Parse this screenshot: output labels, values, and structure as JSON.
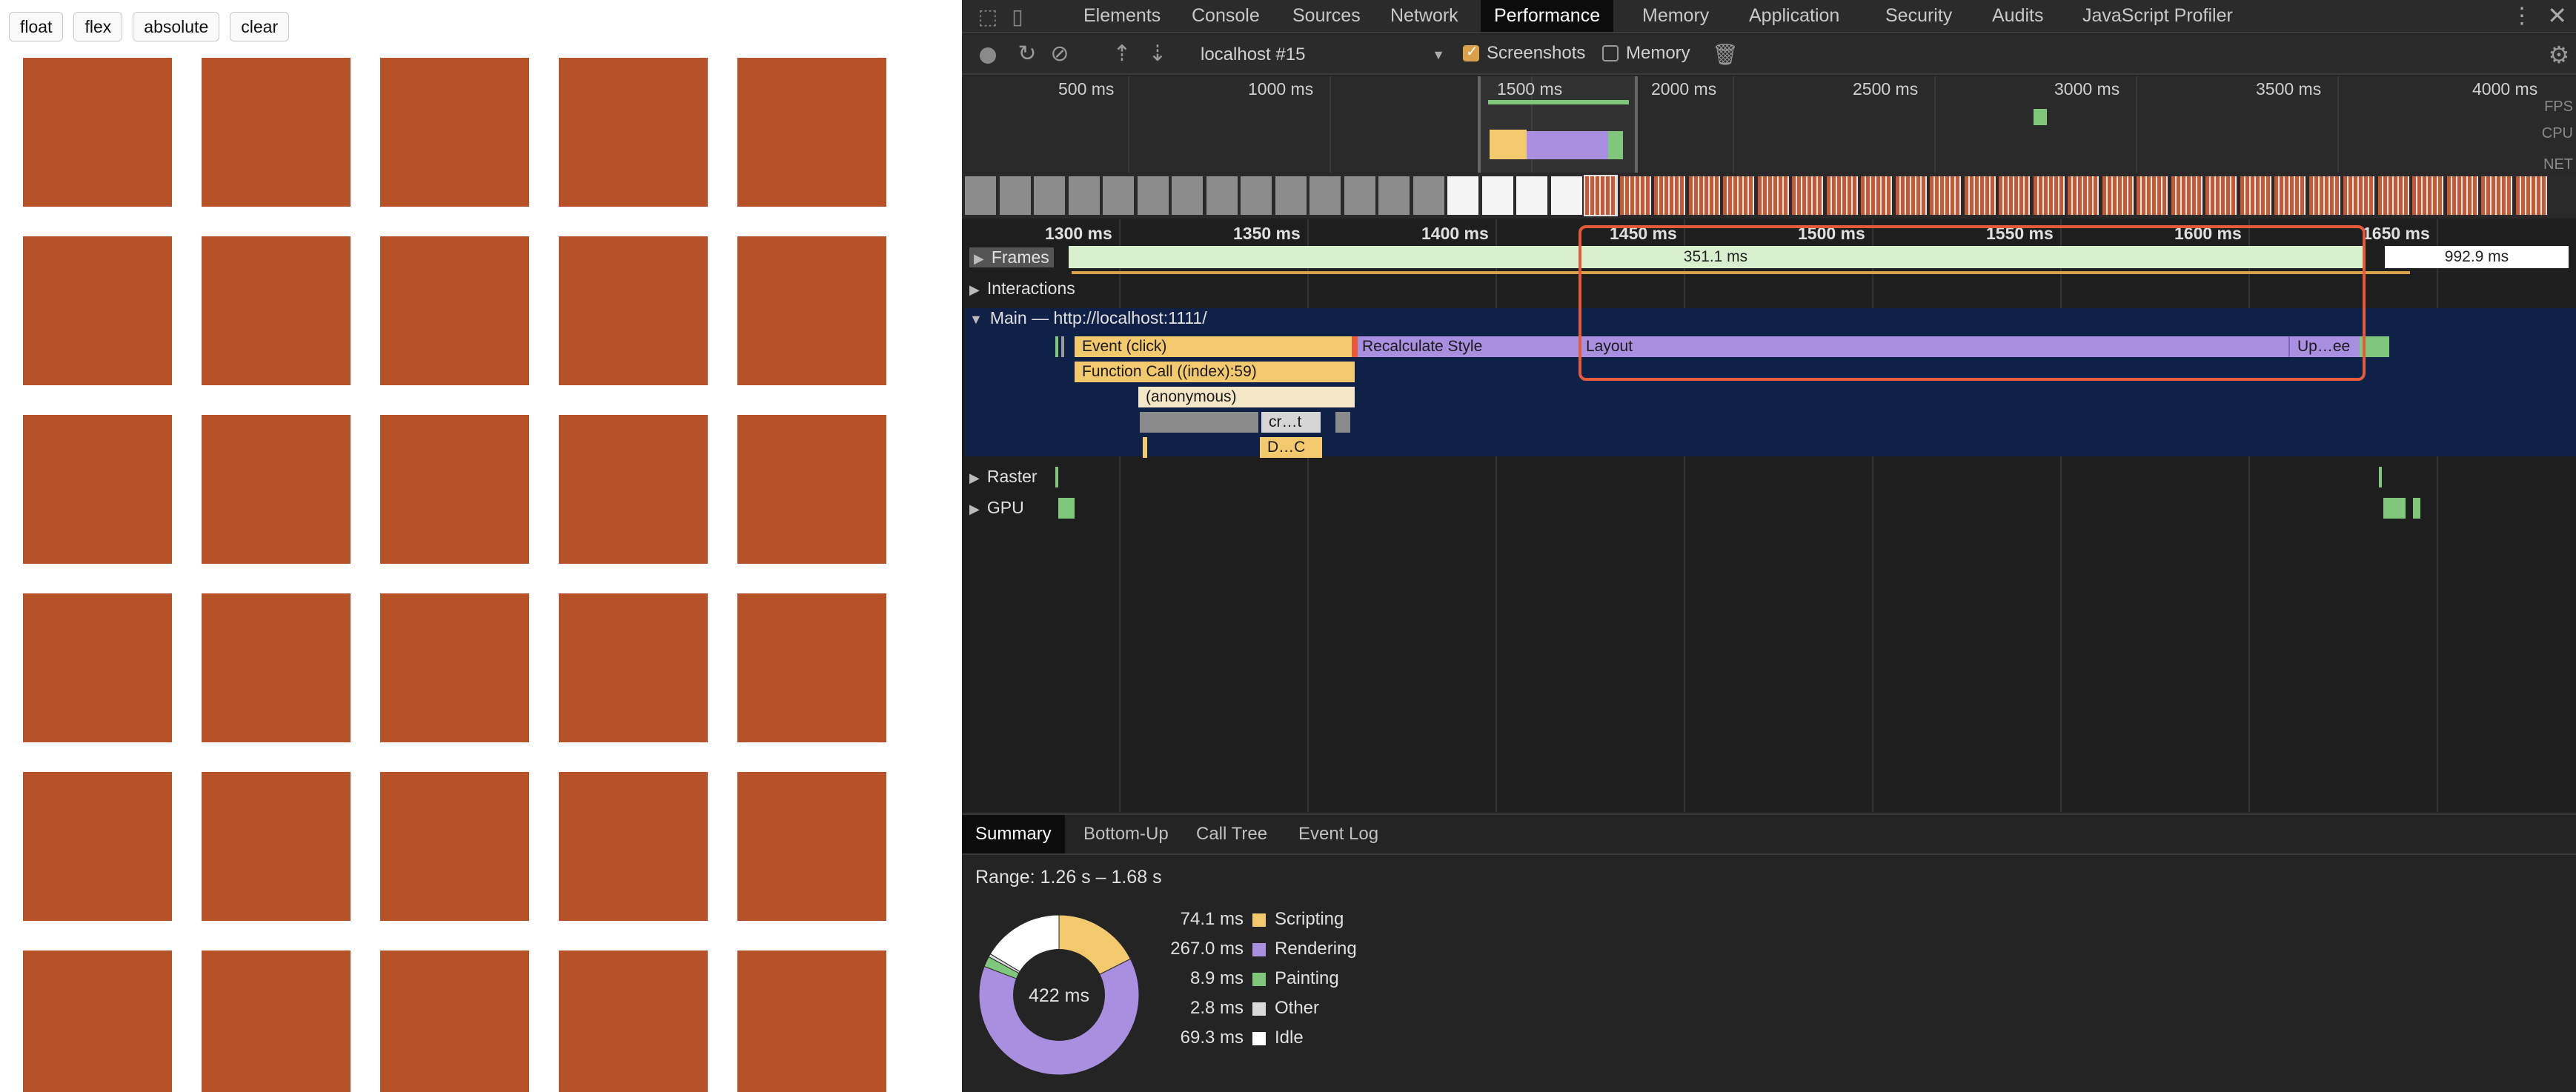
{
  "demo": {
    "buttons": [
      "float",
      "flex",
      "absolute",
      "clear"
    ],
    "box_color": "#b75127"
  },
  "devtools": {
    "tabs": [
      "Elements",
      "Console",
      "Sources",
      "Network",
      "Performance",
      "Memory",
      "Application",
      "Security",
      "Audits",
      "JavaScript Profiler"
    ],
    "active_tab": "Performance",
    "toolbar": {
      "profile": "localhost #15",
      "screenshots_label": "Screenshots",
      "screenshots_checked": true,
      "memory_label": "Memory",
      "memory_checked": false
    },
    "overview": {
      "ticks": [
        "500 ms",
        "1000 ms",
        "1500 ms",
        "2000 ms",
        "2500 ms",
        "3000 ms",
        "3500 ms",
        "4000 ms"
      ],
      "side_labels": [
        "FPS",
        "CPU",
        "NET"
      ]
    },
    "ruler": [
      "1300 ms",
      "1350 ms",
      "1400 ms",
      "1450 ms",
      "1500 ms",
      "1550 ms",
      "1600 ms",
      "1650 ms"
    ],
    "tracks": {
      "frames": "Frames",
      "interactions": "Interactions",
      "main": "Main — http://localhost:1111/",
      "raster": "Raster",
      "gpu": "GPU"
    },
    "frames": {
      "frame1": "351.1 ms",
      "frame2": "992.9 ms"
    },
    "flame": {
      "event_click": "Event (click)",
      "function_call": "Function Call ((index):59)",
      "anonymous": "(anonymous)",
      "recalc_style": "Recalculate Style",
      "layout": "Layout",
      "update": "Up…ee",
      "cr": "cr…t",
      "dc": "D…C"
    },
    "bottom": {
      "tabs": [
        "Summary",
        "Bottom-Up",
        "Call Tree",
        "Event Log"
      ],
      "active_tab": "Summary",
      "range": "Range: 1.26 s – 1.68 s",
      "total": "422 ms",
      "legend": [
        {
          "value": "74.1 ms",
          "label": "Scripting",
          "color": "#f2c96c"
        },
        {
          "value": "267.0 ms",
          "label": "Rendering",
          "color": "#a88fe0"
        },
        {
          "value": "8.9 ms",
          "label": "Painting",
          "color": "#7fc77a"
        },
        {
          "value": "2.8 ms",
          "label": "Other",
          "color": "#dadada"
        },
        {
          "value": "69.3 ms",
          "label": "Idle",
          "color": "#ffffff"
        }
      ]
    },
    "colors": {
      "highlight": "#e55a3b",
      "scripting": "#f2c96c",
      "rendering": "#a88fe0",
      "painting": "#7fc77a",
      "frame_green": "#d9f0cf",
      "main_bg": "#0f2147"
    }
  }
}
